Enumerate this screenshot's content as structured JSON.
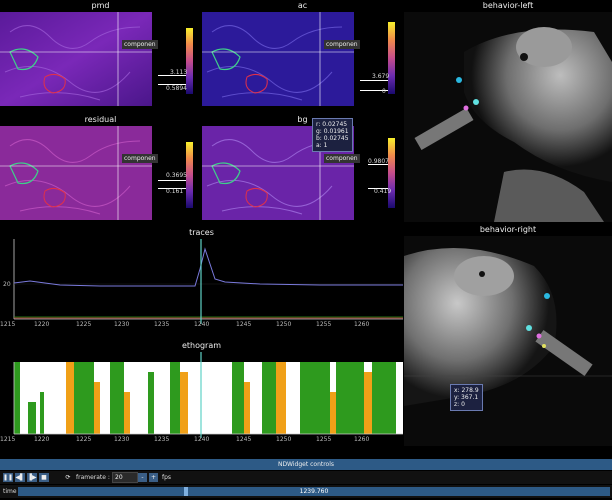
{
  "panels": {
    "pmd": {
      "title": "pmd",
      "component_label": "componen",
      "cbar_max": "3.113",
      "cbar_min": "0.5894"
    },
    "ac": {
      "title": "ac",
      "component_label": "componen",
      "cbar_max": "3.679",
      "cbar_min": "0"
    },
    "residual": {
      "title": "residual",
      "component_label": "componen",
      "cbar_max": "0.3695",
      "cbar_min": "0.161"
    },
    "bg": {
      "title": "bg",
      "component_label": "componen",
      "cbar_max": "0.9807",
      "cbar_min": "0.419"
    },
    "behavior_left": {
      "title": "behavior-left"
    },
    "behavior_right": {
      "title": "behavior-right"
    }
  },
  "tooltip_bg": {
    "r": "r: 0.02745",
    "g": "g: 0.01961",
    "b": "b: 0.02745",
    "a": "a: 1"
  },
  "tooltip_right": {
    "x": "x: 278.9",
    "y": "y: 367.1",
    "z": "z: 0"
  },
  "traces": {
    "title": "traces",
    "ytick_label": "20",
    "xticks": [
      "1215",
      "1220",
      "1225",
      "1230",
      "1235",
      "1240",
      "1245",
      "1250",
      "1255",
      "1260"
    ]
  },
  "ethogram": {
    "title": "ethogram",
    "xticks": [
      "1215",
      "1220",
      "1225",
      "1230",
      "1235",
      "1240",
      "1245",
      "1250",
      "1255",
      "1260"
    ]
  },
  "controls": {
    "bar_label": "NDWidget controls",
    "framerate_label": "framerate :",
    "framerate_value": "20",
    "fps_label": "fps",
    "time_label": "time",
    "time_value": "1239.760",
    "minus": "-",
    "plus": "+"
  },
  "colors": {
    "accent": "#2d5a86",
    "trace": "#7a7adc",
    "ethogram_green": "#2e9a1e",
    "ethogram_orange": "#f0a018",
    "cursor": "#5fd3c6"
  }
}
